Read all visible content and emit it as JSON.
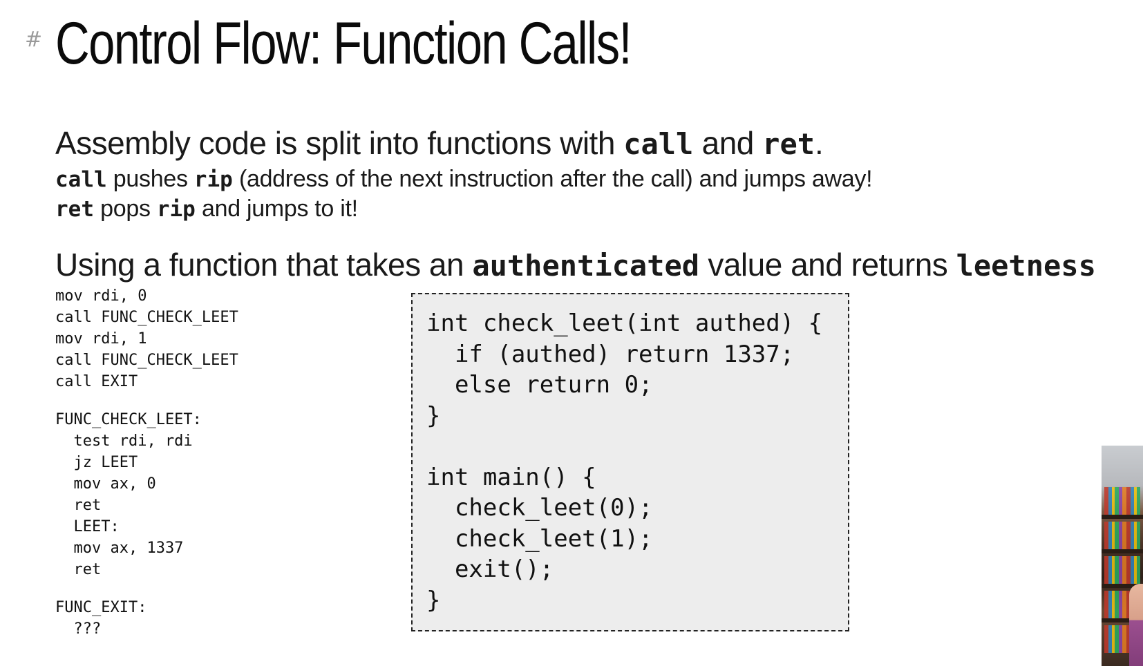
{
  "slide": {
    "hash": "#",
    "title": "Control Flow: Function Calls!"
  },
  "bullets": {
    "line1": {
      "pre": "Assembly code is split into functions with ",
      "code1": "call",
      "mid": " and ",
      "code2": "ret",
      "post": "."
    },
    "line2": {
      "code1": "call",
      "mid1": " pushes ",
      "code2": "rip",
      "post": " (address of the next instruction after the call) and jumps away!"
    },
    "line3": {
      "code1": "ret",
      "mid1": " pops ",
      "code2": "rip",
      "post": " and jumps to it!"
    },
    "line4": {
      "pre": "Using a function that takes an ",
      "code1": "authenticated",
      "mid": " value and returns ",
      "code2": "leetness"
    }
  },
  "asm_code": {
    "block1": [
      "mov rdi, 0",
      "call FUNC_CHECK_LEET",
      "mov rdi, 1",
      "call FUNC_CHECK_LEET",
      "call EXIT"
    ],
    "block2": [
      "FUNC_CHECK_LEET:",
      "  test rdi, rdi",
      "  jz LEET",
      "  mov ax, 0",
      "  ret",
      "  LEET:",
      "  mov ax, 1337",
      "  ret"
    ],
    "block3": [
      "FUNC_EXIT:",
      "  ???"
    ]
  },
  "c_code": {
    "lines": [
      "int check_leet(int authed) {",
      "  if (authed) return 1337;",
      "  else return 0;",
      "}",
      "",
      "int main() {",
      "  check_leet(0);",
      "  check_leet(1);",
      "  exit();",
      "}"
    ]
  },
  "colors": {
    "background": "#ffffff",
    "code_box_background": "#ededed",
    "hash_color": "#9a9a9a"
  }
}
